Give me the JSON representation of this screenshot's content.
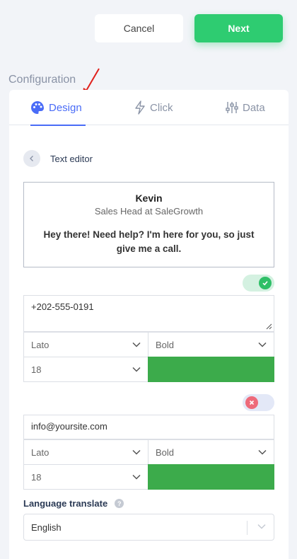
{
  "header": {
    "cancel_label": "Cancel",
    "next_label": "Next"
  },
  "section": {
    "title": "Configuration"
  },
  "tabs": [
    {
      "label": "Design",
      "icon": "palette-icon",
      "active": true
    },
    {
      "label": "Click",
      "icon": "bolt-icon",
      "active": false
    },
    {
      "label": "Data",
      "icon": "sliders-icon",
      "active": false
    }
  ],
  "editor": {
    "back_label": "Text editor"
  },
  "preview": {
    "name": "Kevin",
    "subtitle": "Sales Head at SaleGrowth",
    "message": "Hey there! Need help? I'm here for you, so just give me a call."
  },
  "phone": {
    "enabled": true,
    "value": "+202-555-0191",
    "font": "Lato",
    "weight": "Bold",
    "size": "18",
    "color": "#3cab4b"
  },
  "email": {
    "enabled": false,
    "value": "info@yoursite.com",
    "font": "Lato",
    "weight": "Bold",
    "size": "18",
    "color": "#3cab4b"
  },
  "language": {
    "label": "Language translate",
    "selected": "English"
  },
  "colors": {
    "accent": "#4a6cf7",
    "primary_button": "#2ecc71",
    "annotation_arrow": "#e0201b"
  }
}
